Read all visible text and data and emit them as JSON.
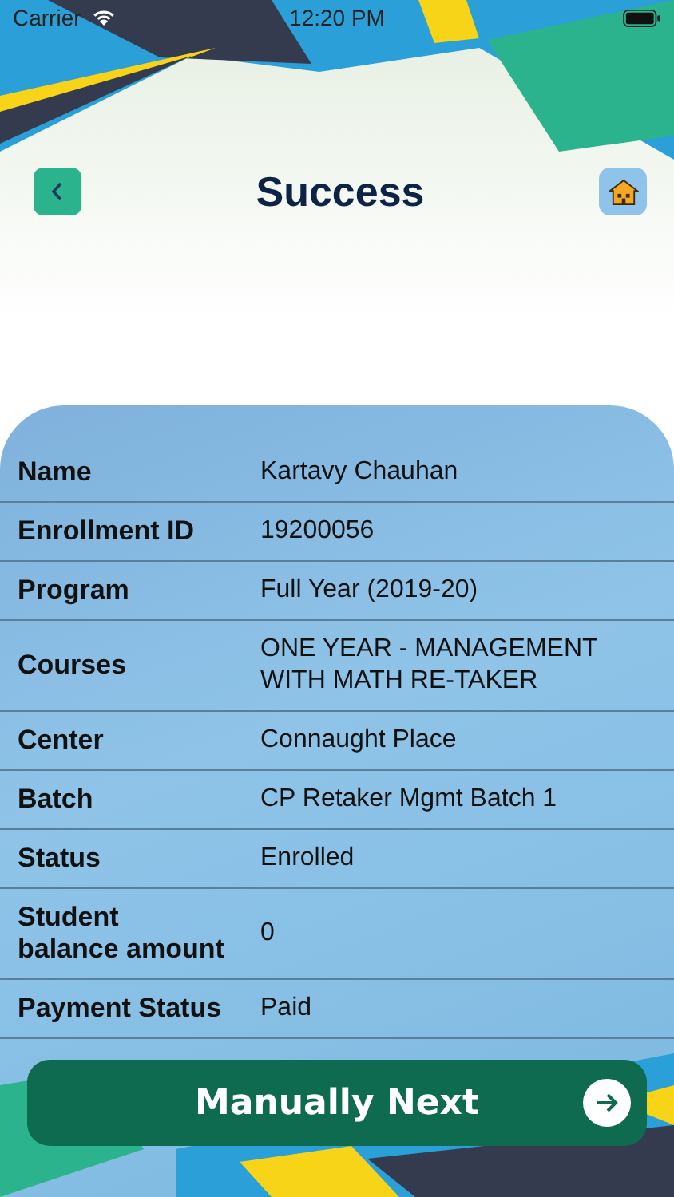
{
  "status_bar": {
    "carrier": "Carrier",
    "time": "12:20 PM"
  },
  "header": {
    "title": "Success"
  },
  "details": [
    {
      "label": "Name",
      "value": "Kartavy Chauhan"
    },
    {
      "label": "Enrollment ID",
      "value": "19200056"
    },
    {
      "label": "Program",
      "value": "Full Year (2019-20)"
    },
    {
      "label": "Courses",
      "value": "ONE YEAR - MANAGEMENT WITH MATH RE-TAKER"
    },
    {
      "label": "Center",
      "value": "Connaught Place"
    },
    {
      "label": "Batch",
      "value": "CP Retaker Mgmt Batch 1"
    },
    {
      "label": "Status",
      "value": "Enrolled"
    },
    {
      "label": "Student\nbalance amount",
      "value": "0"
    },
    {
      "label": "Payment Status",
      "value": "Paid"
    }
  ],
  "primary_button": {
    "label": "Manually Next"
  }
}
